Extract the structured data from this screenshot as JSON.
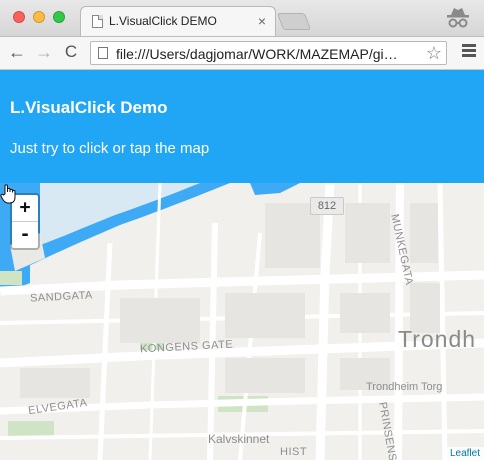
{
  "browser": {
    "tab_title": "L.VisualClick DEMO",
    "tab_close": "×",
    "url": "file:///Users/dagjomar/WORK/MAZEMAP/gi…",
    "nav_back": "←",
    "nav_forward": "→",
    "nav_reload": "C",
    "star": "☆",
    "icons": [
      "close-window",
      "minimize-window",
      "maximize-window",
      "favicon",
      "new-tab",
      "incognito",
      "back",
      "forward",
      "reload",
      "page",
      "bookmark-star",
      "menu"
    ]
  },
  "page": {
    "title": "L.VisualClick Demo",
    "subtitle": "Just try to click or tap the map",
    "header_color": "#20a6f5"
  },
  "map": {
    "zoom_in": "+",
    "zoom_out": "-",
    "road_number": "812",
    "labels": {
      "sandgata": "SANDGATA",
      "kongens_gate": "KONGENS GATE",
      "elvegata": "ELVEGATA",
      "munkegata": "MUNKEGATA",
      "prinsens": "PRINSENS G",
      "city": "Trondh",
      "torg": "Trondheim Torg",
      "kalvskinnet": "Kalvskinnet",
      "hist": "HIST"
    },
    "attribution": "Leaflet",
    "water_color": "#3eaaf6",
    "cursor": "hand-pointer"
  }
}
